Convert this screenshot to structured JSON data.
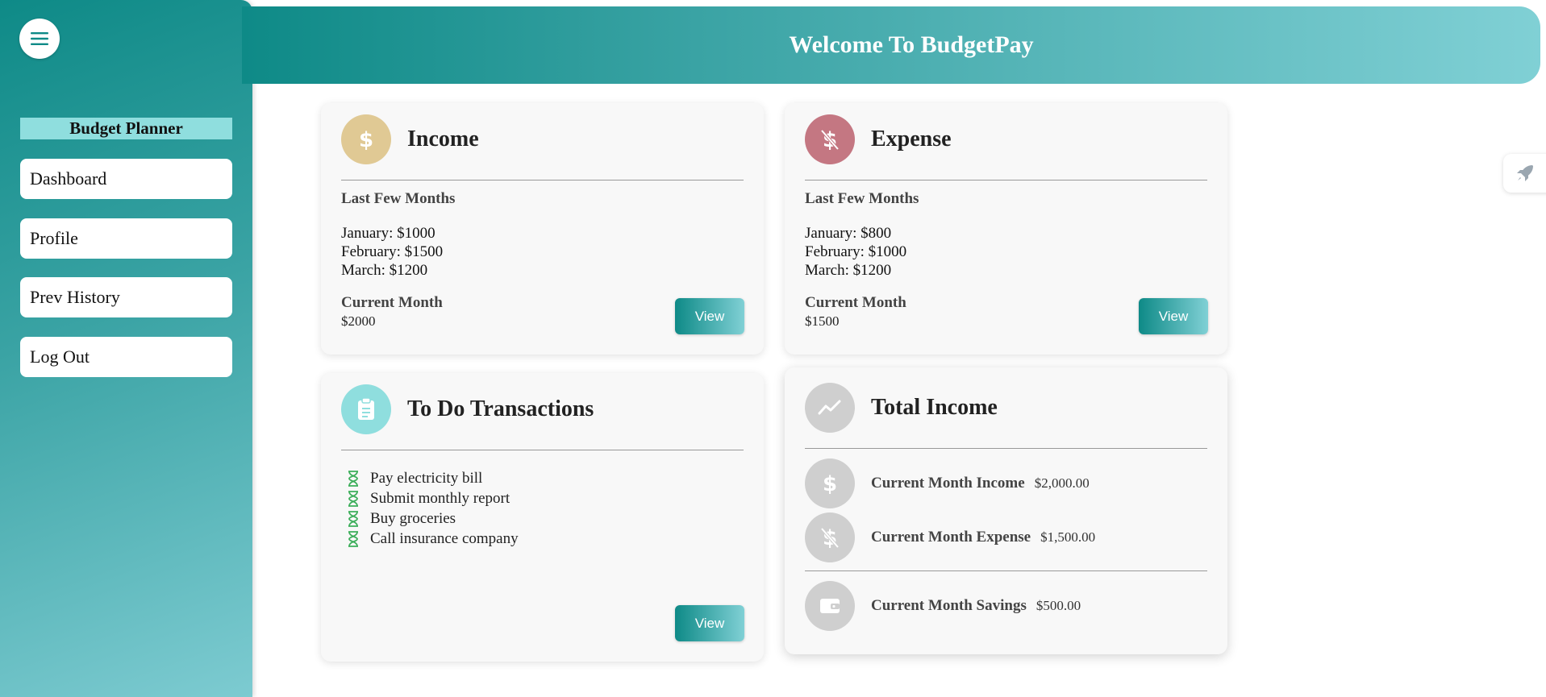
{
  "sidebar": {
    "title": "Budget Planner",
    "items": [
      {
        "label": "Dashboard"
      },
      {
        "label": "Profile"
      },
      {
        "label": "Prev History"
      },
      {
        "label": "Log Out"
      }
    ]
  },
  "header": {
    "title": "Welcome To BudgetPay"
  },
  "income": {
    "title": "Income",
    "subtitle": "Last Few Months",
    "months": [
      "January: $1000",
      "February: $1500",
      "March: $1200"
    ],
    "current_label": "Current Month",
    "current_value": "$2000",
    "button": "View",
    "icon": "dollar-icon",
    "color": "#e0c994"
  },
  "expense": {
    "title": "Expense",
    "subtitle": "Last Few Months",
    "months": [
      "January: $800",
      "February: $1000",
      "March: $1200"
    ],
    "current_label": "Current Month",
    "current_value": "$1500",
    "button": "View",
    "icon": "dollar-off-icon",
    "color": "#c47782"
  },
  "todo": {
    "title": "To Do Transactions",
    "items": [
      "Pay electricity bill",
      "Submit monthly report",
      "Buy groceries",
      "Call insurance company"
    ],
    "button": "View",
    "icon": "clipboard-icon",
    "color": "#8fdede"
  },
  "total": {
    "title": "Total Income",
    "rows": [
      {
        "label": "Current Month Income",
        "value": "$2,000.00"
      },
      {
        "label": "Current Month Expense",
        "value": "$1,500.00"
      },
      {
        "label": "Current Month Savings",
        "value": "$500.00"
      }
    ]
  },
  "colors": {
    "accent": "#0e8a87",
    "accent_light": "#80d0d5"
  }
}
